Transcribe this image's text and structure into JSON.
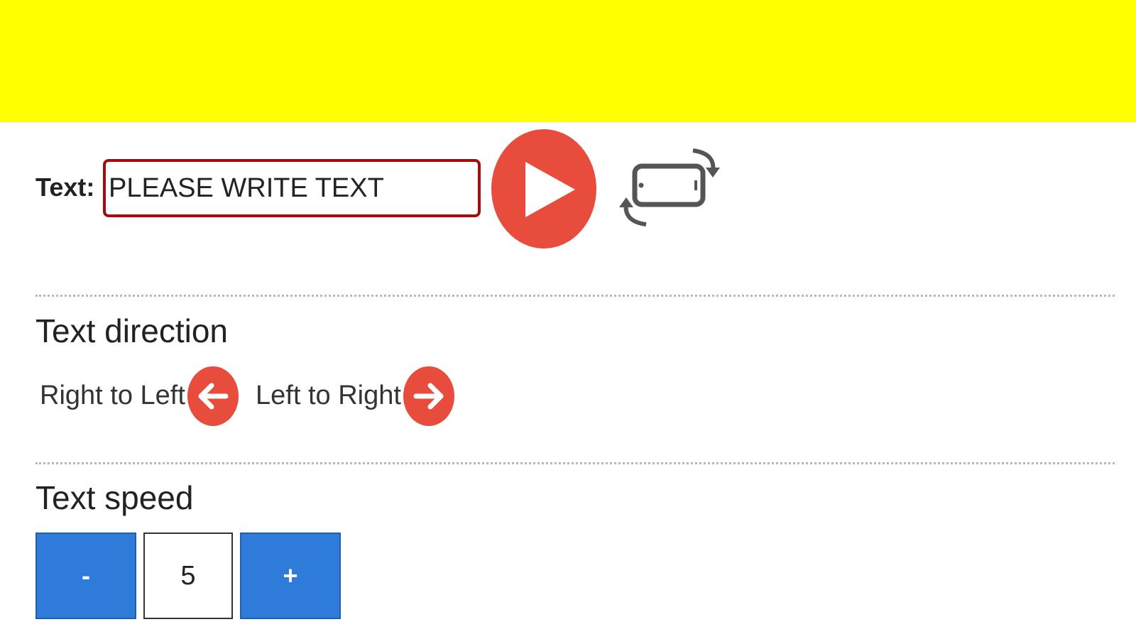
{
  "banner": {
    "color": "#ffff00"
  },
  "text_input": {
    "label": "Text:",
    "value": "",
    "placeholder": "PLEASE WRITE TEXT"
  },
  "icons": {
    "play": "play-icon",
    "rotate": "rotate-device-icon",
    "arrow_left": "arrow-left-icon",
    "arrow_right": "arrow-right-icon"
  },
  "direction": {
    "title": "Text direction",
    "options": [
      {
        "label": "Right to Left",
        "icon": "arrow-left-icon"
      },
      {
        "label": "Left to Right",
        "icon": "arrow-right-icon"
      }
    ]
  },
  "speed": {
    "title": "Text speed",
    "decrement_label": "-",
    "value": "5",
    "increment_label": "+"
  },
  "colors": {
    "accent_red": "#e84c3d",
    "input_border": "#a80b0b",
    "button_blue": "#2f7bd9"
  }
}
